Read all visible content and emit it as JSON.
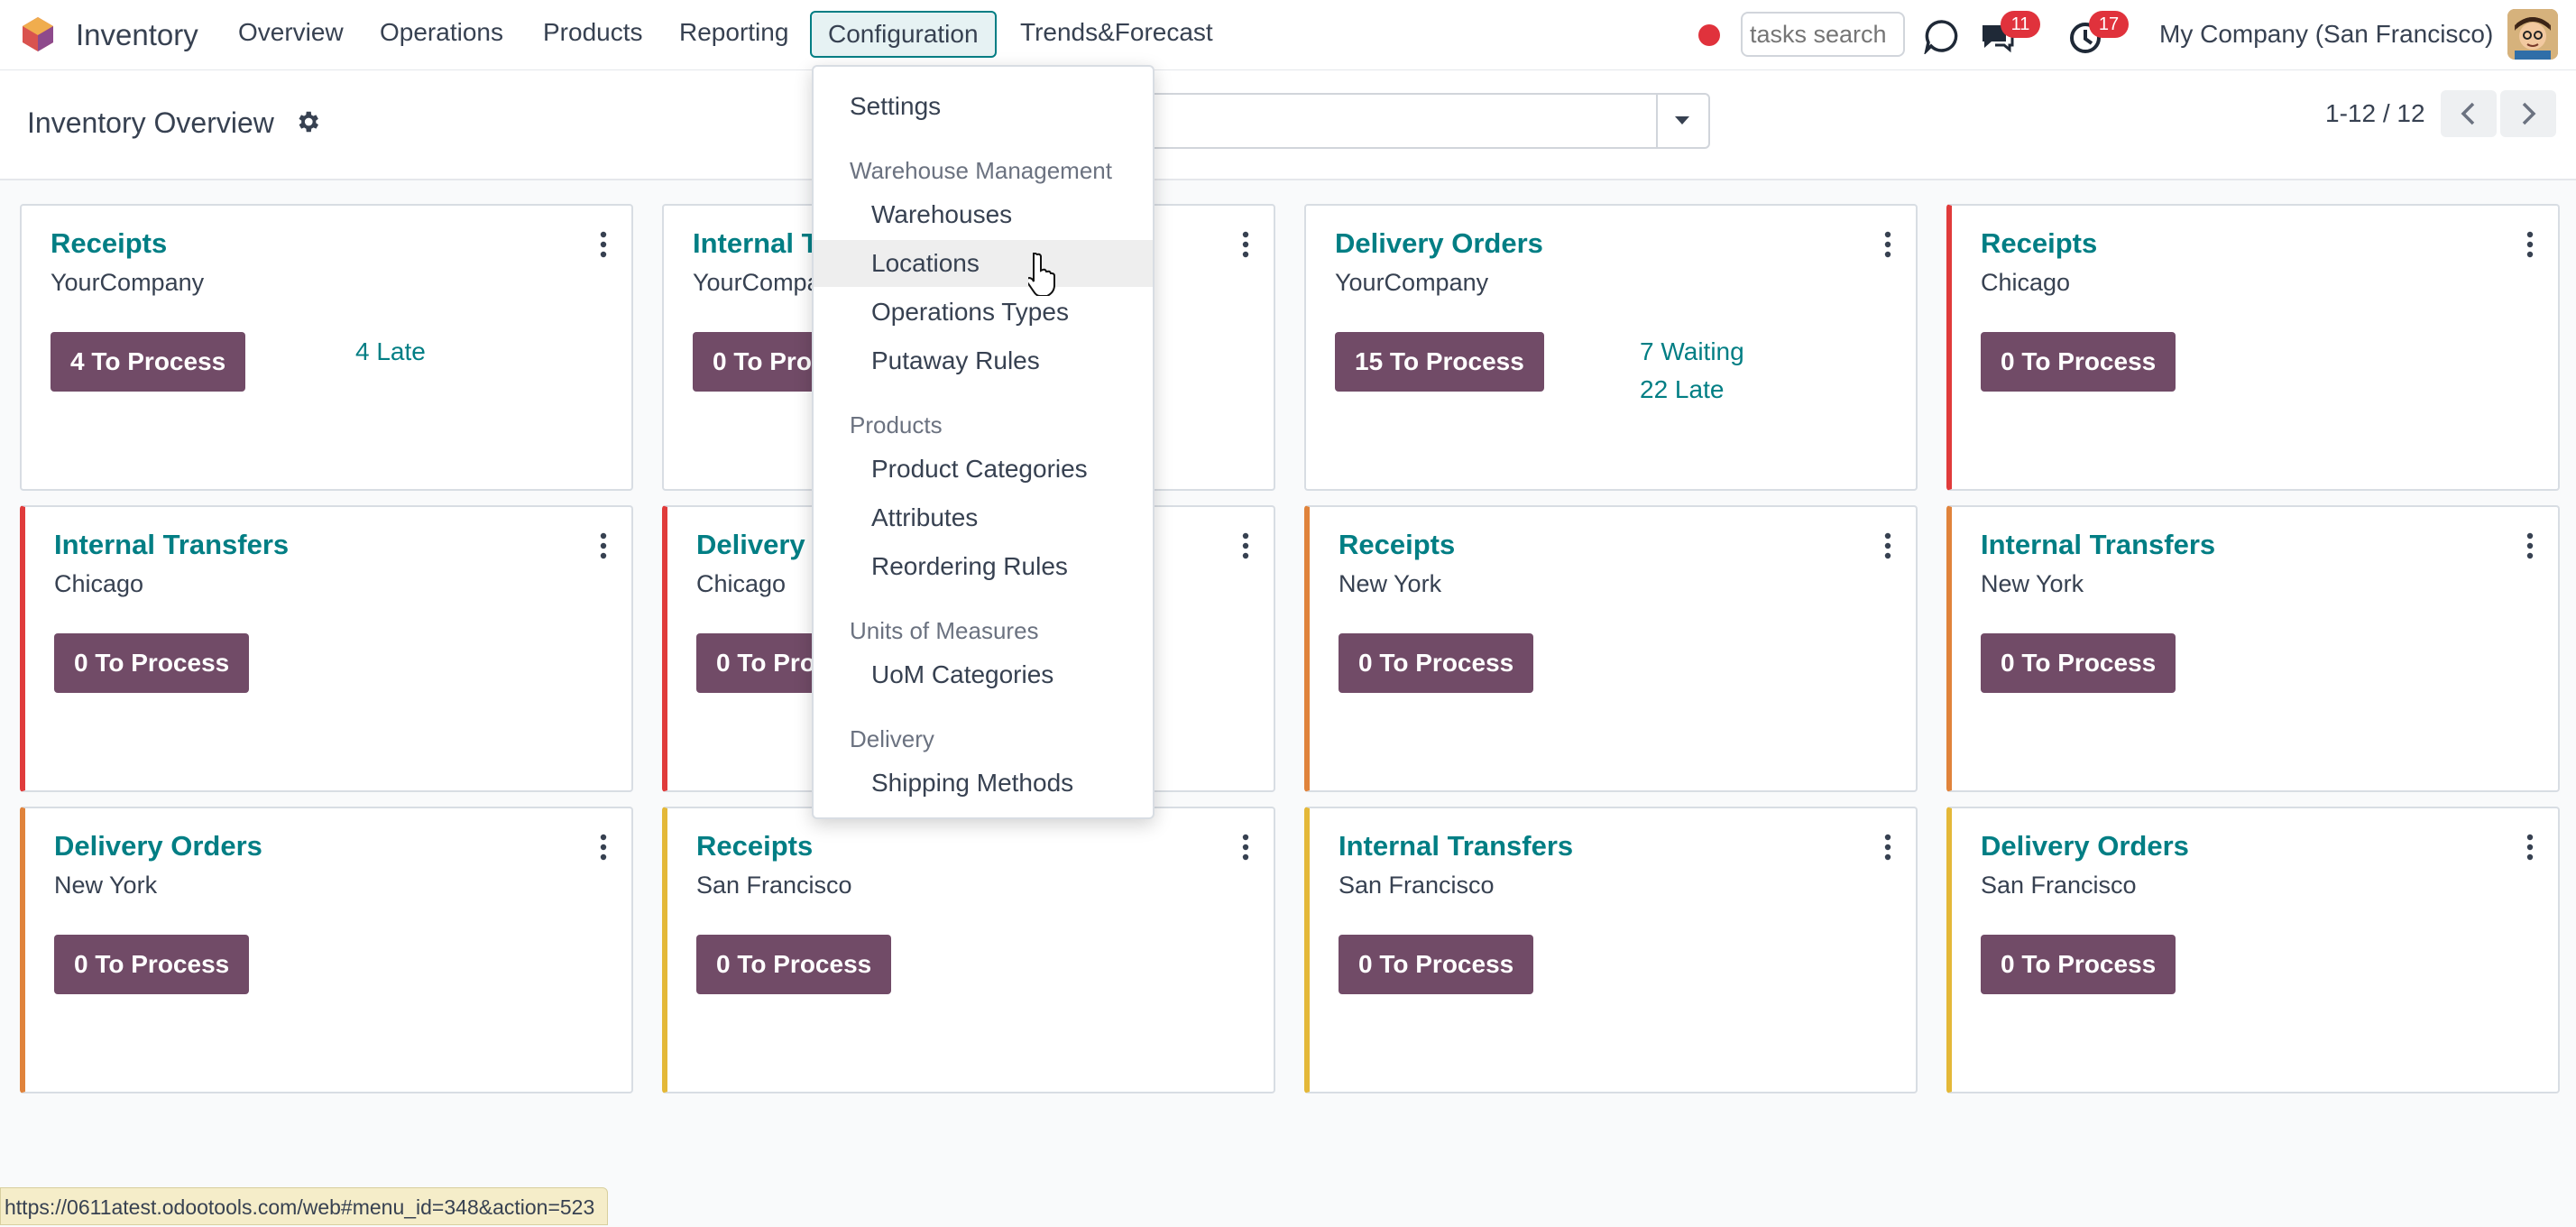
{
  "app": {
    "name": "Inventory"
  },
  "nav": {
    "overview": "Overview",
    "operations": "Operations",
    "products": "Products",
    "reporting": "Reporting",
    "configuration": "Configuration",
    "trends": "Trends&Forecast"
  },
  "topbar": {
    "search_placeholder": "tasks search",
    "messages_count": "11",
    "activities_count": "17",
    "company": "My Company (San Francisco)"
  },
  "control": {
    "title": "Inventory Overview",
    "pager": "1-12 / 12"
  },
  "config_menu": {
    "settings": "Settings",
    "warehouse_header": "Warehouse Management",
    "warehouses": "Warehouses",
    "locations": "Locations",
    "operations_types": "Operations Types",
    "putaway_rules": "Putaway Rules",
    "products_header": "Products",
    "product_categories": "Product Categories",
    "attributes": "Attributes",
    "reordering_rules": "Reordering Rules",
    "uom_header": "Units of Measures",
    "uom_categories": "UoM Categories",
    "delivery_header": "Delivery",
    "shipping_methods": "Shipping Methods"
  },
  "cards": [
    {
      "title": "Receipts",
      "subtitle": "YourCompany",
      "button": "4 To Process",
      "stats": [
        "4 Late"
      ],
      "accent": "none"
    },
    {
      "title": "Internal Transfers",
      "subtitle": "YourCompany",
      "button": "0 To Process",
      "stats": [],
      "accent": "none"
    },
    {
      "title": "Delivery Orders",
      "subtitle": "YourCompany",
      "button": "15 To Process",
      "stats": [
        "7 Waiting",
        "22 Late"
      ],
      "accent": "none"
    },
    {
      "title": "Receipts",
      "subtitle": "Chicago",
      "button": "0 To Process",
      "stats": [],
      "accent": "#e03b3b"
    },
    {
      "title": "Internal Transfers",
      "subtitle": "Chicago",
      "button": "0 To Process",
      "stats": [],
      "accent": "#e03b3b"
    },
    {
      "title": "Delivery Orders",
      "subtitle": "Chicago",
      "button": "0 To Process",
      "stats": [],
      "accent": "#e03b3b"
    },
    {
      "title": "Receipts",
      "subtitle": "New York",
      "button": "0 To Process",
      "stats": [],
      "accent": "#e0833b"
    },
    {
      "title": "Internal Transfers",
      "subtitle": "New York",
      "button": "0 To Process",
      "stats": [],
      "accent": "#e0833b"
    },
    {
      "title": "Delivery Orders",
      "subtitle": "New York",
      "button": "0 To Process",
      "stats": [],
      "accent": "#e0833b"
    },
    {
      "title": "Receipts",
      "subtitle": "San Francisco",
      "button": "0 To Process",
      "stats": [],
      "accent": "#e4b838"
    },
    {
      "title": "Internal Transfers",
      "subtitle": "San Francisco",
      "button": "0 To Process",
      "stats": [],
      "accent": "#e4b838"
    },
    {
      "title": "Delivery Orders",
      "subtitle": "San Francisco",
      "button": "0 To Process",
      "stats": [],
      "accent": "#e4b838"
    }
  ],
  "status_url": "https://0611atest.odootools.com/web#menu_id=348&action=523",
  "colors": {
    "brand": "#714b67",
    "link": "#017e84",
    "red": "#e03b3b",
    "orange": "#e0833b",
    "yellow": "#e4b838"
  },
  "icons": [
    "inventory-logo-icon",
    "gear-icon",
    "chevron-left-icon",
    "chevron-right-icon",
    "kebab-icon",
    "chat-icon",
    "clock-icon",
    "discuss-icon",
    "record-dot-icon",
    "caret-down-icon",
    "hand-cursor-icon"
  ]
}
